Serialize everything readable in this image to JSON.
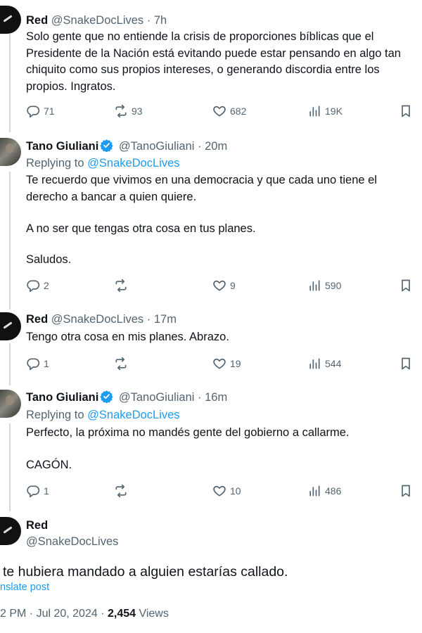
{
  "tweets": [
    {
      "name": "Red",
      "handle": "@SnakeDocLives",
      "time": "7h",
      "verified": false,
      "body": [
        "Solo gente que no entiende la crisis de proporciones bíblicas que el Presidente de la Nación está evitando puede estar pensando en algo tan chiquito como sus propios intereses, o generando discordia entre los propios. Ingratos."
      ],
      "replies": "71",
      "reposts": "93",
      "likes": "682",
      "views": "19K"
    },
    {
      "name": "Tano Giuliani",
      "handle": "@TanoGiuliani",
      "time": "20m",
      "verified": true,
      "replying_label": "Replying to",
      "replying_to": "@SnakeDocLives",
      "body": [
        "Te recuerdo que vivimos en una democracia y que cada uno tiene el derecho a bancar a quien quiere.",
        "A no ser que tengas otra cosa en tus planes.",
        "Saludos."
      ],
      "replies": "2",
      "reposts": "",
      "likes": "9",
      "views": "590"
    },
    {
      "name": "Red",
      "handle": "@SnakeDocLives",
      "time": "17m",
      "verified": false,
      "body": [
        "Tengo otra cosa en mis planes. Abrazo."
      ],
      "replies": "1",
      "reposts": "",
      "likes": "19",
      "views": "544"
    },
    {
      "name": "Tano Giuliani",
      "handle": "@TanoGiuliani",
      "time": "16m",
      "verified": true,
      "replying_label": "Replying to",
      "replying_to": "@SnakeDocLives",
      "body": [
        "Perfecto, la próxima no mandés gente del gobierno a callarme.",
        "CAGÓN."
      ],
      "replies": "1",
      "reposts": "",
      "likes": "10",
      "views": "486"
    }
  ],
  "main_post": {
    "name": "Red",
    "handle": "@SnakeDocLives",
    "body": "te hubiera mandado a alguien estarías callado.",
    "translate": "nslate post",
    "time": "2 PM · Jul 20, 2024 · ",
    "views_count": "2,454",
    "views_label": " Views"
  },
  "colors": {
    "link": "#1d9bf0",
    "muted": "#536471",
    "text": "#0f1419",
    "thread_line": "#cfd9de"
  }
}
